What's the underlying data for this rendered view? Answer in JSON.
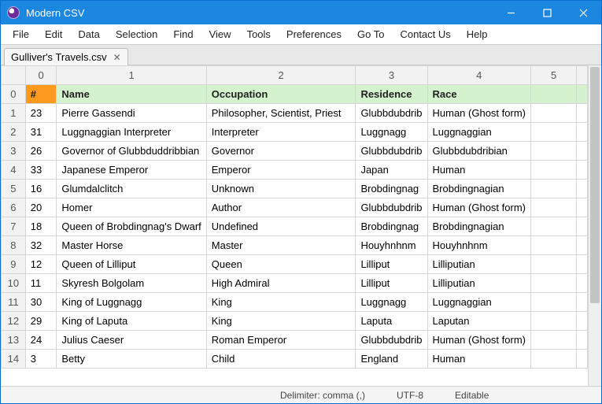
{
  "window": {
    "title": "Modern CSV"
  },
  "menu": [
    "File",
    "Edit",
    "Data",
    "Selection",
    "Find",
    "View",
    "Tools",
    "Preferences",
    "Go To",
    "Contact Us",
    "Help"
  ],
  "tab": {
    "label": "Gulliver's Travels.csv"
  },
  "columns": [
    "0",
    "1",
    "2",
    "3",
    "4",
    "5"
  ],
  "header_row": {
    "idx": "0",
    "cells": [
      "#",
      "Name",
      "Occupation",
      "Residence",
      "Race",
      ""
    ]
  },
  "rows": [
    {
      "idx": "1",
      "c": [
        "23",
        "Pierre Gassendi",
        "Philosopher, Scientist, Priest",
        "Glubbdubdrib",
        "Human (Ghost form)",
        ""
      ]
    },
    {
      "idx": "2",
      "c": [
        "31",
        "Luggnaggian Interpreter",
        "Interpreter",
        "Luggnagg",
        "Luggnaggian",
        ""
      ]
    },
    {
      "idx": "3",
      "c": [
        "26",
        "Governor of Glubbduddribbian",
        "Governor",
        "Glubbdubdrib",
        "Glubbdubdribian",
        ""
      ]
    },
    {
      "idx": "4",
      "c": [
        "33",
        "Japanese Emperor",
        "Emperor",
        "Japan",
        "Human",
        ""
      ]
    },
    {
      "idx": "5",
      "c": [
        "16",
        "Glumdalclitch",
        "Unknown",
        "Brobdingnag",
        "Brobdingnagian",
        ""
      ]
    },
    {
      "idx": "6",
      "c": [
        "20",
        "Homer",
        "Author",
        "Glubbdubdrib",
        "Human (Ghost form)",
        ""
      ]
    },
    {
      "idx": "7",
      "c": [
        "18",
        "Queen of Brobdingnag's Dwarf",
        "Undefined",
        "Brobdingnag",
        "Brobdingnagian",
        ""
      ]
    },
    {
      "idx": "8",
      "c": [
        "32",
        "Master Horse",
        "Master",
        "Houyhnhnm",
        "Houyhnhnm",
        ""
      ]
    },
    {
      "idx": "9",
      "c": [
        "12",
        "Queen of Lilliput",
        "Queen",
        "Lilliput",
        "Lilliputian",
        ""
      ]
    },
    {
      "idx": "10",
      "c": [
        "11",
        "Skyresh Bolgolam",
        "High Admiral",
        "Lilliput",
        "Lilliputian",
        ""
      ]
    },
    {
      "idx": "11",
      "c": [
        "30",
        "King of Luggnagg",
        "King",
        "Luggnagg",
        "Luggnaggian",
        ""
      ]
    },
    {
      "idx": "12",
      "c": [
        "29",
        "King of Laputa",
        "King",
        "Laputa",
        "Laputan",
        ""
      ]
    },
    {
      "idx": "13",
      "c": [
        "24",
        "Julius Caeser",
        "Roman Emperor",
        "Glubbdubdrib",
        "Human (Ghost form)",
        ""
      ]
    },
    {
      "idx": "14",
      "c": [
        "3",
        "Betty",
        "Child",
        "England",
        "Human",
        ""
      ]
    }
  ],
  "status": {
    "delimiter": "Delimiter: comma (,)",
    "encoding": "UTF-8",
    "mode": "Editable"
  }
}
